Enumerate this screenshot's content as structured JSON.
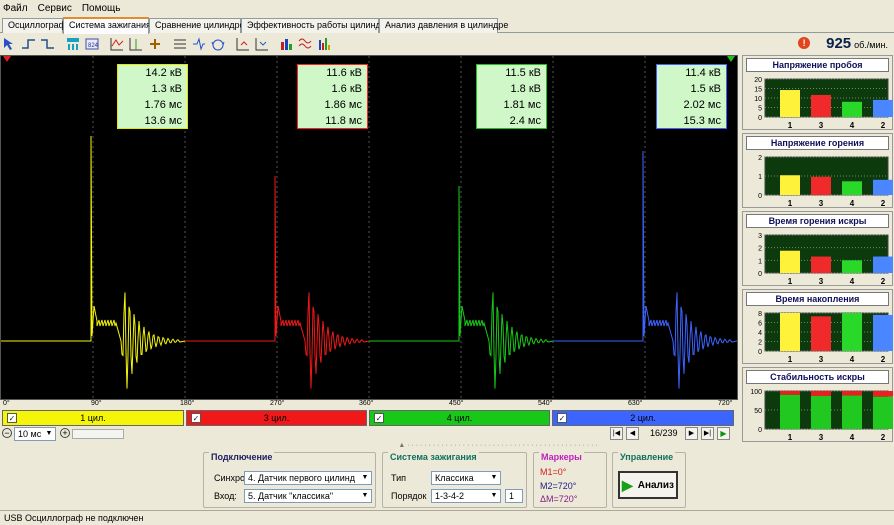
{
  "menu": [
    "Файл",
    "Сервис",
    "Помощь"
  ],
  "tabs": [
    "Осциллограф",
    "Система зажигания",
    "Сравнение цилиндров",
    "Эффективность работы цилиндров",
    "Анализ давления в цилиндре"
  ],
  "active_tab": 1,
  "rpm": {
    "value": "925",
    "unit": "об./мин."
  },
  "readouts": [
    {
      "lines": [
        "14.2 кВ",
        "1.3 кВ",
        "1.76 мс",
        "13.6 мс"
      ],
      "color": "#e6e600"
    },
    {
      "lines": [
        "11.6 кВ",
        "1.6 кВ",
        "1.86 мс",
        "11.8 мс"
      ],
      "color": "#ff2020"
    },
    {
      "lines": [
        "11.5 кВ",
        "1.8 кВ",
        "1.81 мс",
        "2.4 мс"
      ],
      "color": "#20c020"
    },
    {
      "lines": [
        "11.4 кВ",
        "1.5 кВ",
        "2.02 мс",
        "15.3 мс"
      ],
      "color": "#4060ff"
    }
  ],
  "axis_labels": [
    "0°",
    "90°",
    "180°",
    "270°",
    "360°",
    "450°",
    "540°",
    "630°",
    "720°"
  ],
  "cylinders": [
    {
      "label": "1 цил.",
      "color": "#f5f50a"
    },
    {
      "label": "3 цил.",
      "color": "#f01818"
    },
    {
      "label": "4 цил.",
      "color": "#18c818"
    },
    {
      "label": "2 цил.",
      "color": "#3c64ff"
    }
  ],
  "timebase": "10 мс",
  "page": "16/239",
  "connection": {
    "title": "Подключение",
    "sync_label": "Синхро:",
    "sync_value": "4.  Датчик первого цилинд",
    "input_label": "Вход:",
    "input_value": "5.  Датчик \"классика\""
  },
  "ignition": {
    "title": "Система зажигания",
    "type_label": "Тип",
    "type_value": "Классика",
    "order_label": "Порядок",
    "order_value": "1-3-4-2",
    "order_num": "1"
  },
  "markers": {
    "title": "Маркеры",
    "m1": "M1=0°",
    "m2": "M2=720°",
    "dm": "ΔM=720°"
  },
  "control": {
    "title": "Управление",
    "analyze": "Анализ"
  },
  "status": "USB Осциллограф не подключен",
  "charts": [
    {
      "title": "Напряжение пробоя",
      "ticks": [
        "20",
        "15",
        "10",
        "5",
        "0"
      ],
      "ymax": 20,
      "values": [
        14.2,
        11.6,
        8,
        9
      ],
      "cats": [
        "1",
        "3",
        "4",
        "2"
      ]
    },
    {
      "title": "Напряжение горения",
      "ticks": [
        "2",
        "1",
        "0"
      ],
      "ymax": 2.5,
      "values": [
        1.3,
        1.2,
        0.9,
        1.0
      ],
      "cats": [
        "1",
        "3",
        "4",
        "2"
      ]
    },
    {
      "title": "Время горения искры",
      "ticks": [
        "3",
        "2",
        "1",
        "0"
      ],
      "ymax": 3,
      "values": [
        1.76,
        1.3,
        1.0,
        1.3
      ],
      "cats": [
        "1",
        "3",
        "4",
        "2"
      ]
    },
    {
      "title": "Время накопления",
      "ticks": [
        "8",
        "6",
        "4",
        "2",
        "0"
      ],
      "ymax": 8,
      "values": [
        8.2,
        7.3,
        8,
        7.6
      ],
      "cats": [
        "1",
        "3",
        "4",
        "2"
      ]
    },
    {
      "title": "Стабильность искры",
      "ticks": [
        "100",
        "50",
        "0"
      ],
      "ymax": 100,
      "values": [
        90,
        87,
        88,
        85
      ],
      "cats": [
        "1",
        "3",
        "4",
        "2"
      ],
      "stacked_top": [
        10,
        13,
        12,
        15
      ]
    }
  ],
  "chart_data": [
    {
      "type": "bar",
      "title": "Напряжение пробоя",
      "categories": [
        "1",
        "3",
        "4",
        "2"
      ],
      "values": [
        14.2,
        11.6,
        8,
        9
      ],
      "ylim": [
        0,
        20
      ]
    },
    {
      "type": "bar",
      "title": "Напряжение горения",
      "categories": [
        "1",
        "3",
        "4",
        "2"
      ],
      "values": [
        1.3,
        1.2,
        0.9,
        1.0
      ],
      "ylim": [
        0,
        2.5
      ]
    },
    {
      "type": "bar",
      "title": "Время горения искры",
      "categories": [
        "1",
        "3",
        "4",
        "2"
      ],
      "values": [
        1.76,
        1.3,
        1.0,
        1.3
      ],
      "ylim": [
        0,
        3
      ]
    },
    {
      "type": "bar",
      "title": "Время накопления",
      "categories": [
        "1",
        "3",
        "4",
        "2"
      ],
      "values": [
        8.2,
        7.3,
        8,
        7.6
      ],
      "ylim": [
        0,
        8
      ]
    },
    {
      "type": "bar",
      "title": "Стабильность искры",
      "categories": [
        "1",
        "3",
        "4",
        "2"
      ],
      "values": [
        90,
        87,
        88,
        85
      ],
      "ylim": [
        0,
        100
      ]
    }
  ]
}
